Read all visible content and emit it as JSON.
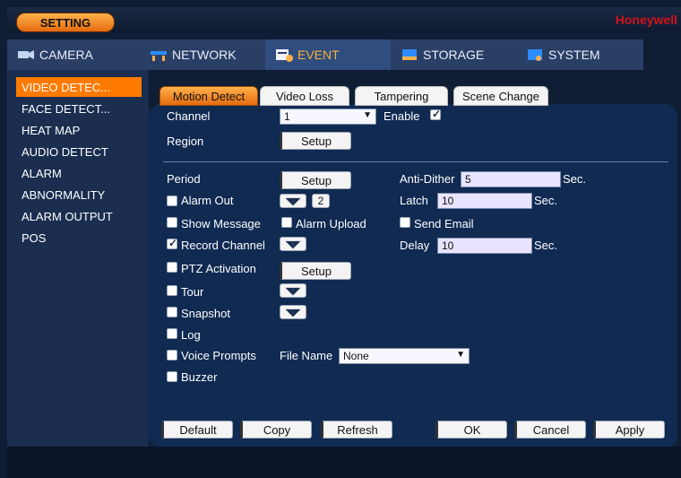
{
  "header": {
    "setting_label": "SETTING",
    "brand": "Honeywell"
  },
  "main_tabs": [
    {
      "label": "CAMERA",
      "icon": "camera-icon"
    },
    {
      "label": "NETWORK",
      "icon": "network-icon"
    },
    {
      "label": "EVENT",
      "icon": "event-icon"
    },
    {
      "label": "STORAGE",
      "icon": "storage-icon"
    },
    {
      "label": "SYSTEM",
      "icon": "system-icon"
    }
  ],
  "sidebar": {
    "items": [
      {
        "label": "VIDEO DETEC..."
      },
      {
        "label": "FACE DETECT..."
      },
      {
        "label": "HEAT MAP"
      },
      {
        "label": "AUDIO DETECT"
      },
      {
        "label": "ALARM"
      },
      {
        "label": "ABNORMALITY"
      },
      {
        "label": "ALARM OUTPUT"
      },
      {
        "label": "POS"
      }
    ]
  },
  "sub_tabs": [
    "Motion Detect",
    "Video Loss",
    "Tampering",
    "Scene Change"
  ],
  "form": {
    "channel_label": "Channel",
    "channel_value": "1",
    "enable_label": "Enable",
    "region_label": "Region",
    "setup_label": "Setup",
    "period_label": "Period",
    "anti_dither_label": "Anti-Dither",
    "anti_dither_value": "5",
    "sec_label": "Sec.",
    "alarm_out_label": "Alarm Out",
    "alarm_out_count": "2",
    "latch_label": "Latch",
    "latch_value": "10",
    "show_message_label": "Show Message",
    "alarm_upload_label": "Alarm Upload",
    "send_email_label": "Send Email",
    "record_channel_label": "Record Channel",
    "delay_label": "Delay",
    "delay_value": "10",
    "ptz_activation_label": "PTZ Activation",
    "tour_label": "Tour",
    "snapshot_label": "Snapshot",
    "log_label": "Log",
    "voice_prompts_label": "Voice Prompts",
    "file_name_label": "File Name",
    "file_name_value": "None",
    "buzzer_label": "Buzzer"
  },
  "footer_buttons": {
    "default": "Default",
    "copy": "Copy",
    "refresh": "Refresh",
    "ok": "OK",
    "cancel": "Cancel",
    "apply": "Apply"
  },
  "colors": {
    "accent_orange": "#ff7a00",
    "brand_red": "#d3131b",
    "panel_blue": "#102a52"
  }
}
